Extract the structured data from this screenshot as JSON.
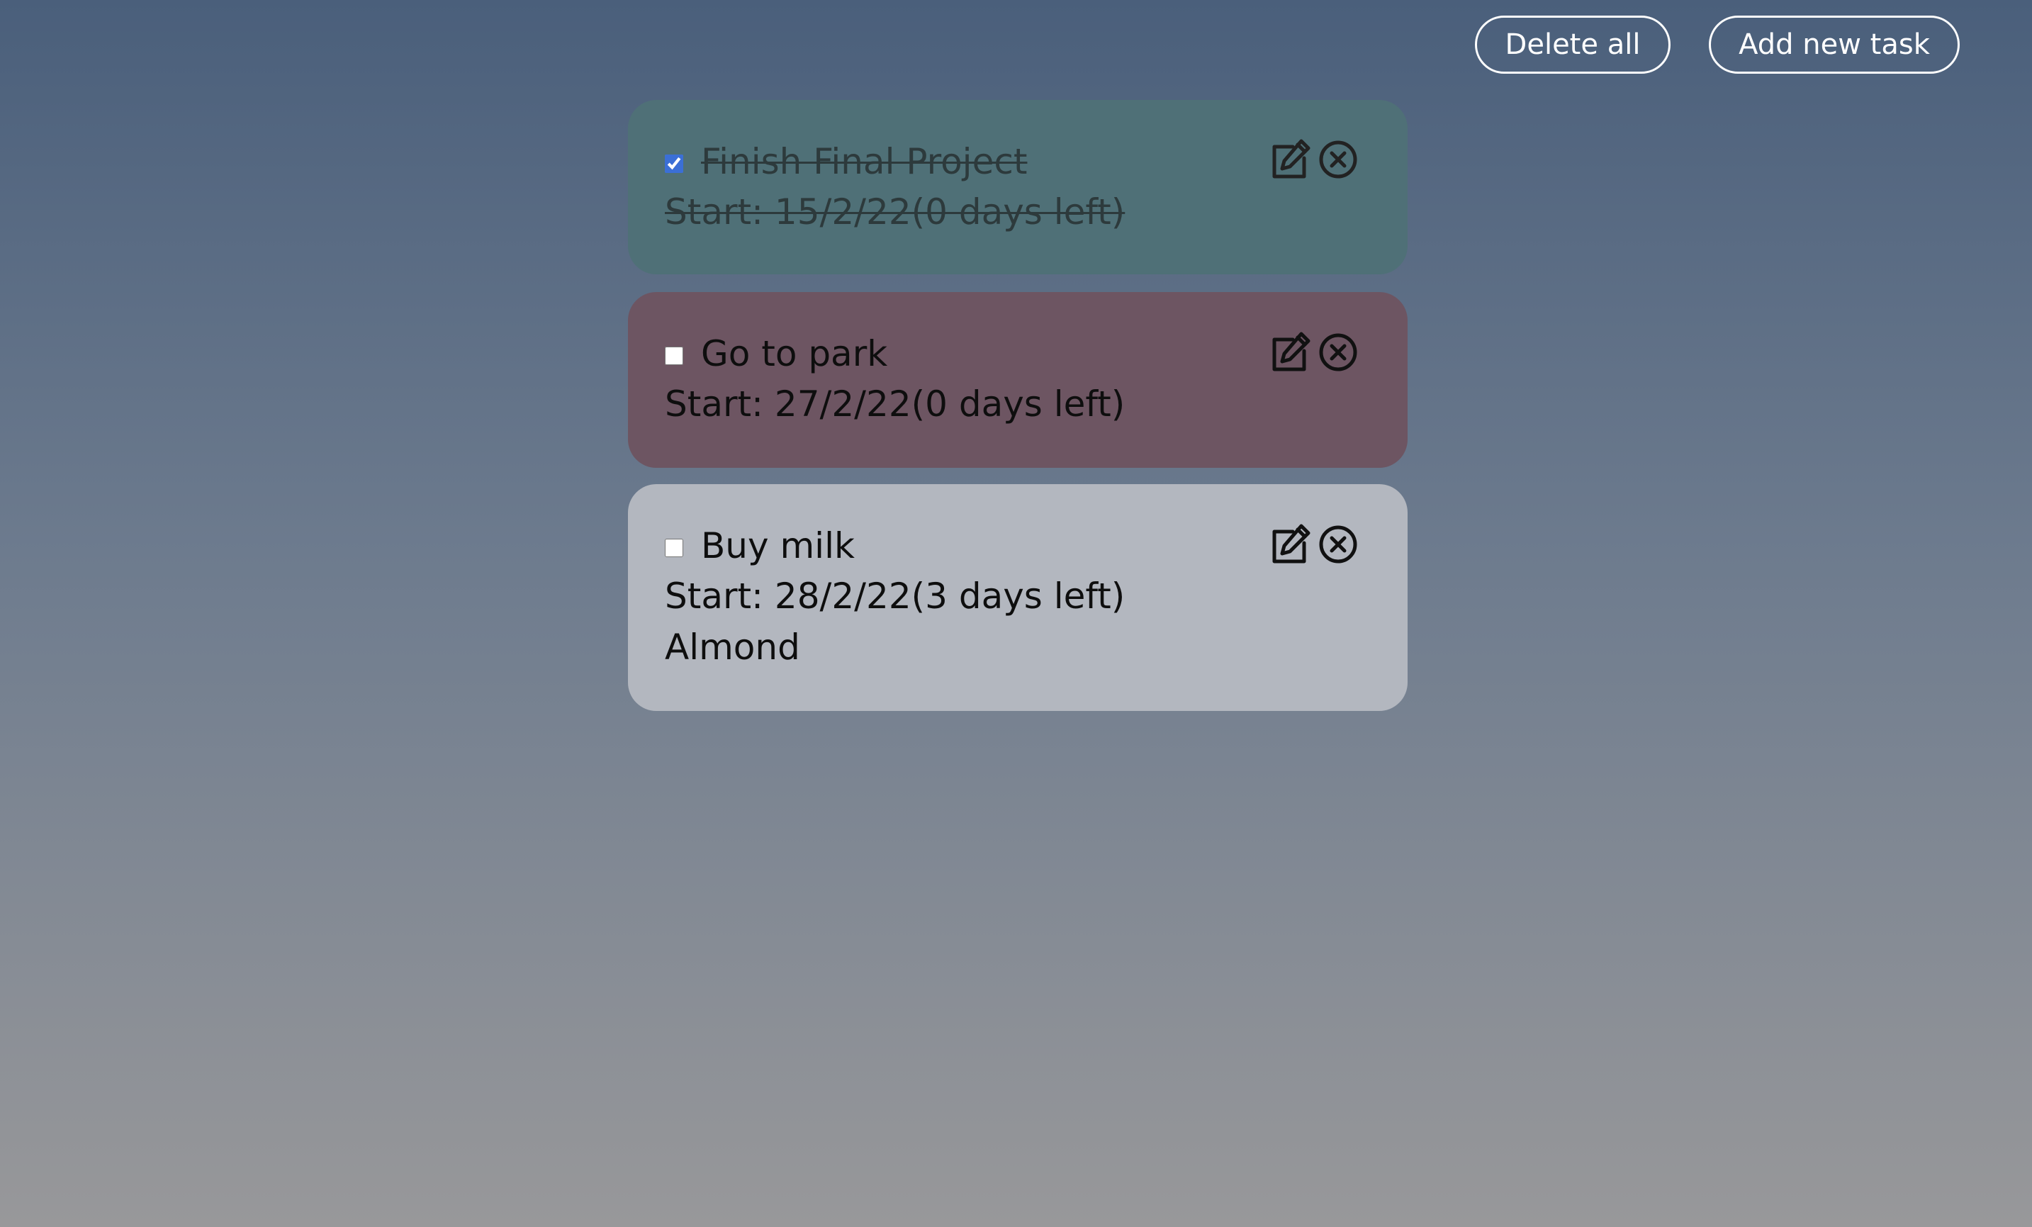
{
  "toolbar": {
    "delete_all_label": "Delete all",
    "add_task_label": "Add new task"
  },
  "tasks": [
    {
      "title": "Finish Final Project",
      "date_text": "Start: 15/2/22(0 days left)",
      "completed": true,
      "background": "#4f7077"
    },
    {
      "title": "Go to park",
      "date_text": "Start: 27/2/22(0 days left)",
      "completed": false,
      "background": "#6d5562"
    },
    {
      "title": "Buy milk",
      "date_text": "Start: 28/2/22(3 days left)",
      "description": "Almond",
      "completed": false,
      "background": "#b3b7bf"
    }
  ],
  "icons": {
    "edit": "edit-icon",
    "delete": "close-circle-icon"
  },
  "colors": {
    "button_border": "#ffffff",
    "checkbox_accent": "#3b6fd6"
  }
}
